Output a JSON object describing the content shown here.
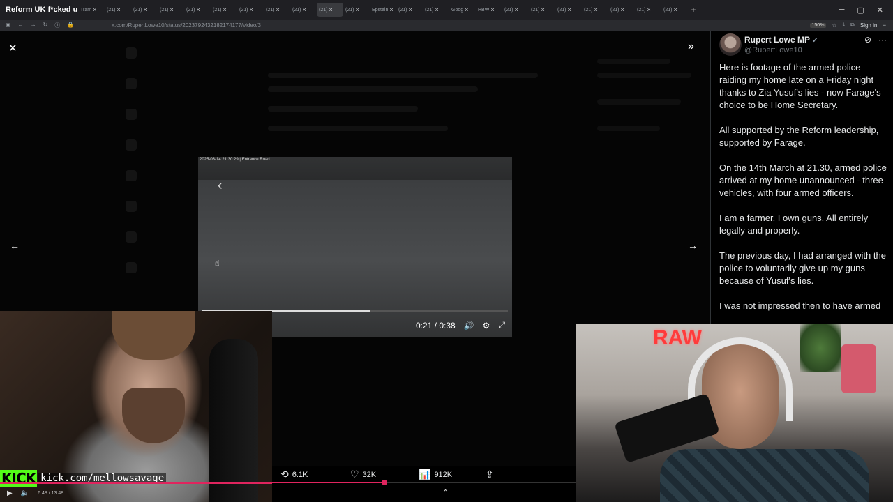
{
  "browser": {
    "first_tab_title": "Reform UK f*cked up..",
    "tabs": [
      {
        "label": "Tram"
      },
      {
        "label": "(21)"
      },
      {
        "label": "(21)"
      },
      {
        "label": "(21)"
      },
      {
        "label": "(21)"
      },
      {
        "label": "(21)"
      },
      {
        "label": "(21)"
      },
      {
        "label": "(21)"
      },
      {
        "label": "(21)"
      },
      {
        "label": "(21)",
        "active": true
      },
      {
        "label": "(21)"
      },
      {
        "label": "Epstein"
      },
      {
        "label": "(21)"
      },
      {
        "label": "(21)"
      },
      {
        "label": "Goog"
      },
      {
        "label": "HBW"
      },
      {
        "label": "(21)"
      },
      {
        "label": "(21)"
      },
      {
        "label": "(21)"
      },
      {
        "label": "(21)"
      },
      {
        "label": "(21)"
      },
      {
        "label": "(21)"
      },
      {
        "label": "(21)"
      }
    ],
    "new_tab": "+",
    "url": "x.com/RupertLowe10/status/2023792432182174177/video/3",
    "zoom": "150%",
    "signin": "Sign in"
  },
  "icons": {
    "close": "✕",
    "expand": "»",
    "prev": "←",
    "next": "→",
    "back": "‹",
    "cursor": "☝",
    "verified": "✔",
    "grok": "⊘",
    "more": "···",
    "volume": "🔊",
    "settings": "⚙",
    "fullscreen": "⤢",
    "retweet": "⟲",
    "like": "♡",
    "views": "📊",
    "share": "⇪",
    "chevron_up": "⌃",
    "play": "▶",
    "mute": "🔈"
  },
  "video": {
    "stamp": "2025-03-14 21:30:29 | Entrance Road",
    "current_time": "0:21",
    "separator": " / ",
    "duration": "0:38",
    "progress_fraction": 0.55
  },
  "tweet": {
    "author_name": "Rupert Lowe MP",
    "handle": "@RupertLowe10",
    "paragraphs": [
      "Here is footage of the armed police raiding my home late on a Friday night thanks to Zia Yusuf's lies - now Farage's choice to be Home Secretary.",
      "All supported by the Reform leadership, supported by Farage.",
      "On the 14th March at 21.30, armed police arrived at my home unannounced - three vehicles, with four armed officers.",
      "I am a farmer. I own guns. All entirely legally and properly.",
      "The previous day, I had arranged with the police to voluntarily give up my guns because of Yusuf's lies.",
      "I was not impressed then to have armed"
    ],
    "actions": {
      "retweets": "6.1K",
      "likes": "32K",
      "views": "912K"
    },
    "playback_fraction": 0.37
  },
  "stream": {
    "kick_logo": "KICK",
    "kick_url": "kick.com/mellowsavage",
    "player_time": "6:48 / 13:48",
    "seek_fraction": 1.0,
    "sign_text": "RAW"
  },
  "colors": {
    "kick_green": "#53fc18",
    "progress_red": "#e0245e",
    "background": "#000000"
  }
}
